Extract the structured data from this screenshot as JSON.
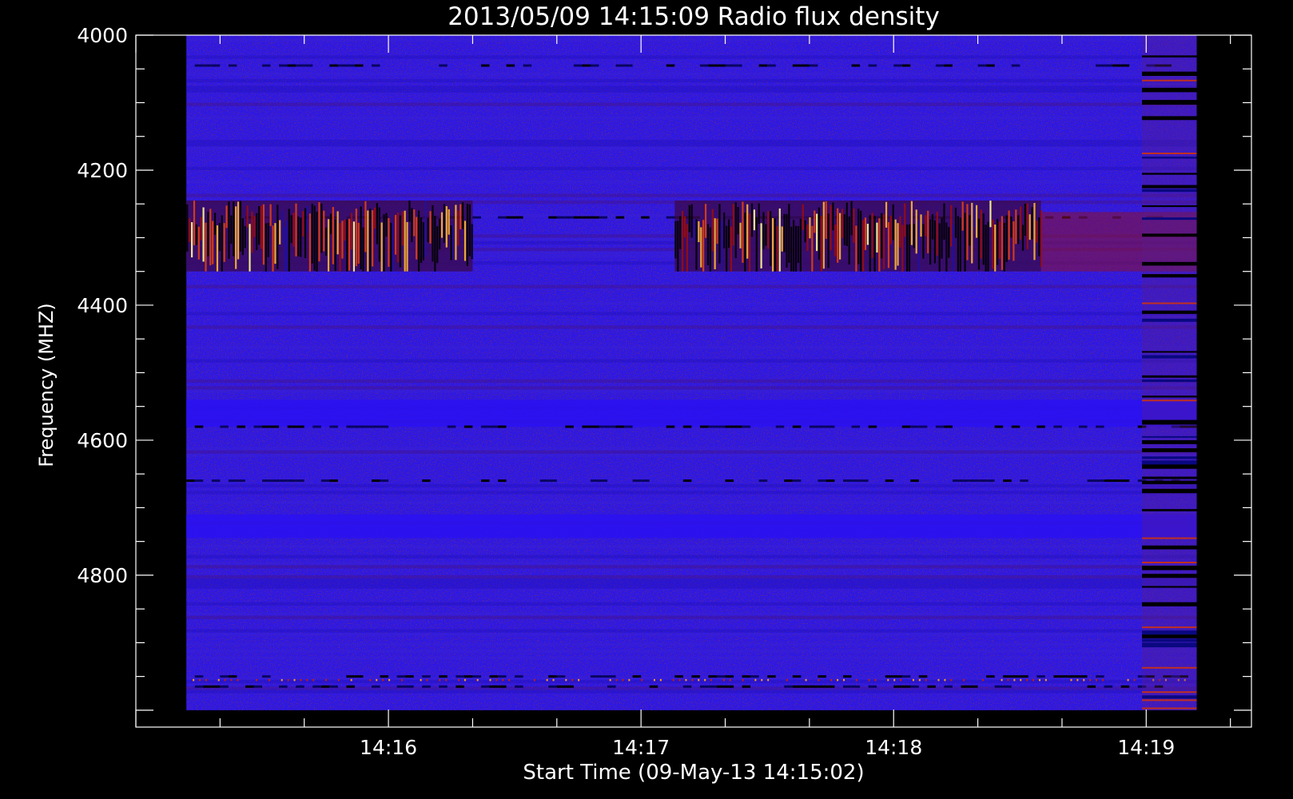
{
  "chart_data": {
    "type": "heatmap",
    "title": "2013/05/09 14:15:09 Radio flux density",
    "xlabel": "Start Time (09-May-13 14:15:02)",
    "ylabel": "Frequency (MHZ)",
    "x_ticks": [
      {
        "label": "14:16",
        "value": 58
      },
      {
        "label": "14:17",
        "value": 118
      },
      {
        "label": "14:18",
        "value": 178
      },
      {
        "label": "14:19",
        "value": 238
      }
    ],
    "y_ticks": [
      {
        "label": "4000",
        "value": 4000
      },
      {
        "label": "4200",
        "value": 4200
      },
      {
        "label": "4400",
        "value": 4400
      },
      {
        "label": "4600",
        "value": 4600
      },
      {
        "label": "4800",
        "value": 4800
      }
    ],
    "xlim_seconds_from_start": [
      -2,
      263
    ],
    "ylim_mhz": [
      4000,
      5025
    ],
    "y_inverted": true,
    "data_extent_seconds": [
      10,
      250
    ],
    "data_extent_mhz": [
      4000,
      5000
    ],
    "colormap": "black-blue-red-yellow-white",
    "colors": {
      "background": "#000000",
      "baseline": "#2a18e8",
      "axis": "#ffffff"
    },
    "bright_regions": [
      {
        "time_range": [
          10,
          78
        ],
        "freq_range": [
          4245,
          4350
        ]
      },
      {
        "time_range": [
          126,
          213
        ],
        "freq_range": [
          4245,
          4350
        ]
      }
    ],
    "rfi_band_mhz": [
      4045,
      4270,
      4580,
      4660,
      4950,
      4965
    ]
  }
}
